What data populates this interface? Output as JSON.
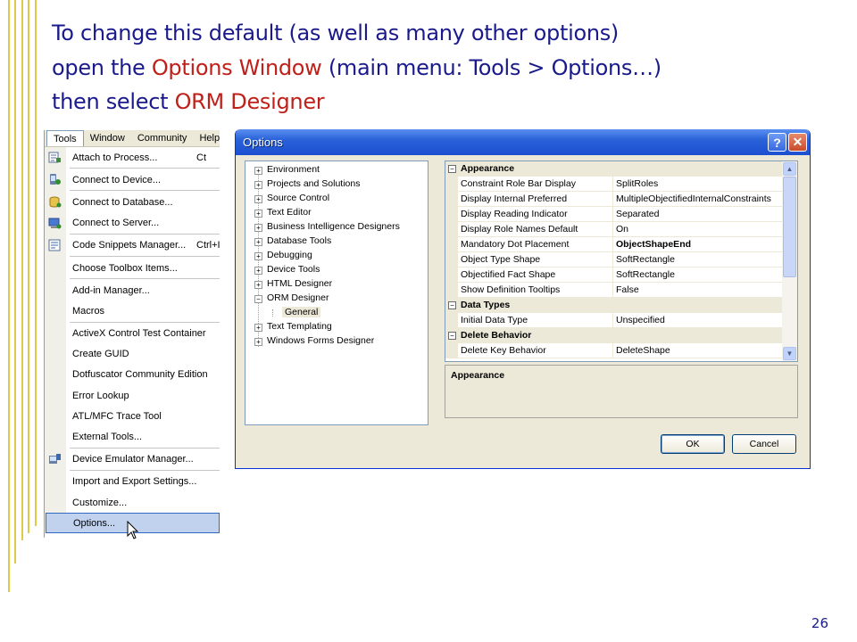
{
  "slide": {
    "line1": "To change this default (as well as many other options)",
    "line2_a": "open the ",
    "line2_hl": "Options Window",
    "line2_b": " (main menu: Tools > Options…)",
    "line3_a": "then select ",
    "line3_hl": "ORM Designer",
    "page_number": "26",
    "text_color": "#1a1a8c",
    "highlight_color": "#c0201a"
  },
  "tools_menu": {
    "menubar": [
      "Tools",
      "Window",
      "Community",
      "Help"
    ],
    "items": [
      {
        "label": "Attach to Process...",
        "shortcut": "Ct",
        "icon": "attach-process-icon"
      },
      {
        "label": "Connect to Device...",
        "icon": "device-icon"
      },
      {
        "label": "Connect to Database...",
        "icon": "database-icon"
      },
      {
        "label": "Connect to Server...",
        "icon": "server-icon"
      },
      {
        "label": "Code Snippets Manager...",
        "shortcut": "Ctrl+I",
        "icon": "snippets-icon"
      },
      {
        "label": "Choose Toolbox Items..."
      },
      {
        "label": "Add-in Manager..."
      },
      {
        "label": "Macros"
      },
      {
        "label": "ActiveX Control Test Container"
      },
      {
        "label": "Create GUID"
      },
      {
        "label": "Dotfuscator Community Edition"
      },
      {
        "label": "Error Lookup"
      },
      {
        "label": "ATL/MFC Trace Tool"
      },
      {
        "label": "External Tools..."
      },
      {
        "label": "Device Emulator Manager...",
        "icon": "emulator-icon"
      },
      {
        "label": "Import and Export Settings..."
      },
      {
        "label": "Customize..."
      },
      {
        "label": "Options..."
      }
    ]
  },
  "options_dialog": {
    "title": "Options",
    "help_label": "?",
    "close_label": "✕",
    "tree": [
      {
        "label": "Environment",
        "toggle": "+"
      },
      {
        "label": "Projects and Solutions",
        "toggle": "+"
      },
      {
        "label": "Source Control",
        "toggle": "+"
      },
      {
        "label": "Text Editor",
        "toggle": "+"
      },
      {
        "label": "Business Intelligence Designers",
        "toggle": "+"
      },
      {
        "label": "Database Tools",
        "toggle": "+"
      },
      {
        "label": "Debugging",
        "toggle": "+"
      },
      {
        "label": "Device Tools",
        "toggle": "+"
      },
      {
        "label": "HTML Designer",
        "toggle": "+"
      },
      {
        "label": "ORM Designer",
        "toggle": "−"
      },
      {
        "label": "General",
        "child": true
      },
      {
        "label": "Text Templating",
        "toggle": "+"
      },
      {
        "label": "Windows Forms Designer",
        "toggle": "+"
      }
    ],
    "properties": [
      {
        "category": "Appearance"
      },
      {
        "name": "Constraint Role Bar Display",
        "value": "SplitRoles"
      },
      {
        "name": "Display Internal Preferred",
        "value": "MultipleObjectifiedInternalConstraints"
      },
      {
        "name": "Display Reading Indicator",
        "value": "Separated"
      },
      {
        "name": "Display Role Names Default",
        "value": "On"
      },
      {
        "name": "Mandatory Dot Placement",
        "value": "ObjectShapeEnd",
        "bold": true
      },
      {
        "name": "Object Type Shape",
        "value": "SoftRectangle"
      },
      {
        "name": "Objectified Fact Shape",
        "value": "SoftRectangle"
      },
      {
        "name": "Show Definition Tooltips",
        "value": "False"
      },
      {
        "category": "Data Types"
      },
      {
        "name": "Initial Data Type",
        "value": "Unspecified"
      },
      {
        "category": "Delete Behavior"
      },
      {
        "name": "Delete Key Behavior",
        "value": "DeleteShape"
      }
    ],
    "description_title": "Appearance",
    "ok_label": "OK",
    "cancel_label": "Cancel"
  }
}
